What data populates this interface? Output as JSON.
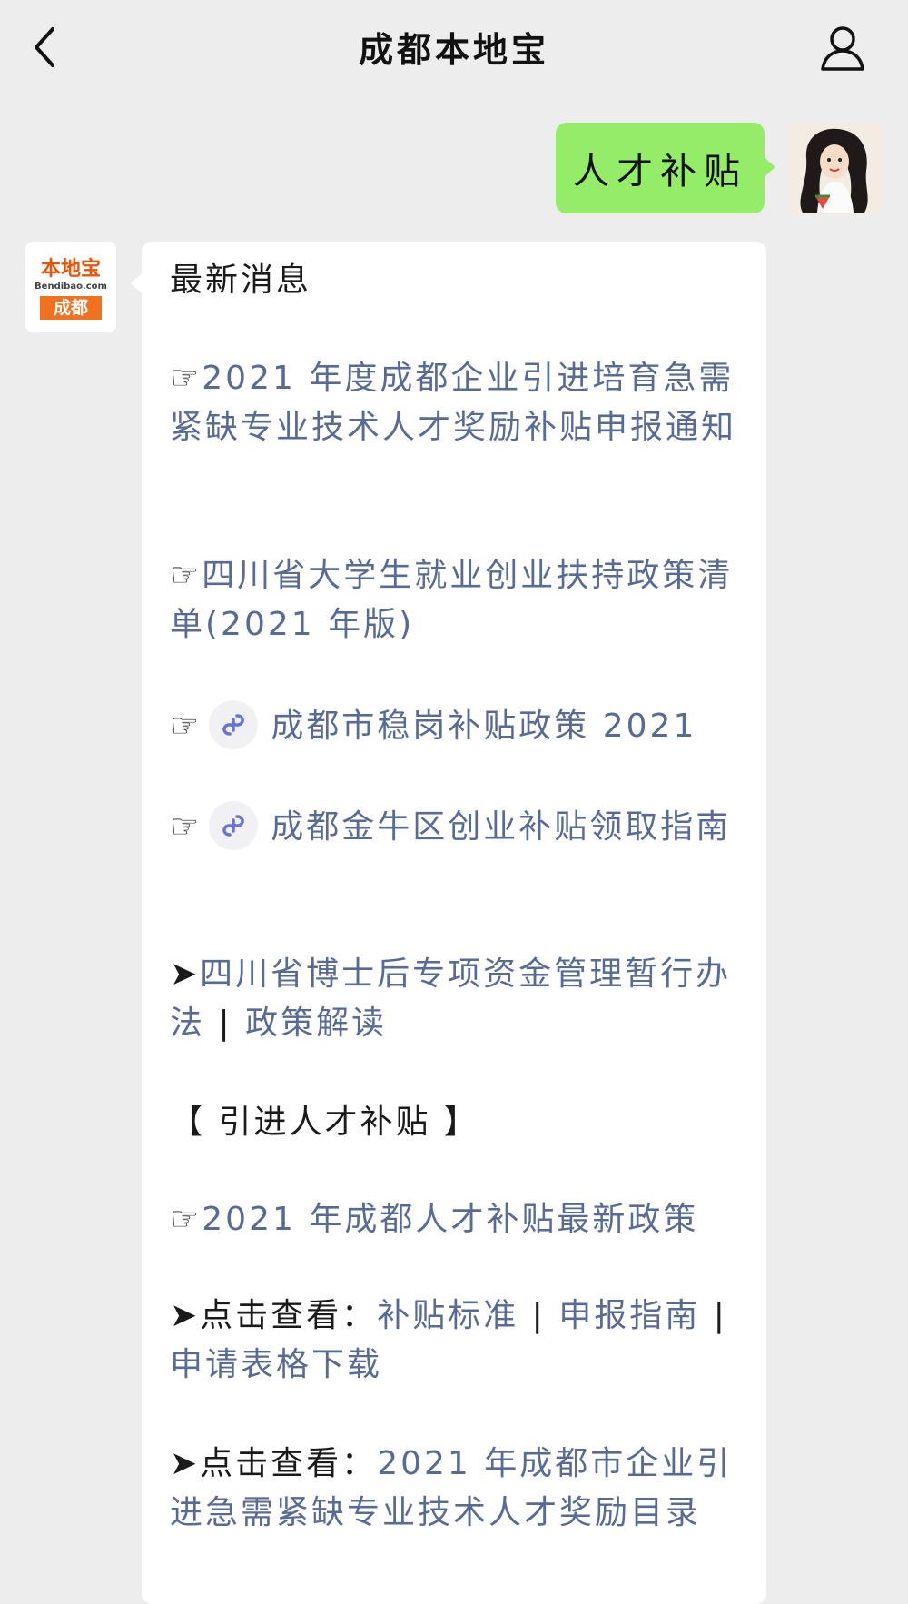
{
  "header": {
    "title": "成都本地宝"
  },
  "outgoing": {
    "text": "人才补贴"
  },
  "bot": {
    "avatar_brand": "本地宝",
    "avatar_domain": "Bendibao.com",
    "avatar_city": "成都"
  },
  "message": {
    "heading": "最新消息",
    "pointer_hand": "☞",
    "arrow": "➤",
    "item1": "2021 年度成都企业引进培育急需紧缺专业技术人才奖励补贴申报通知",
    "item2": "四川省大学生就业创业扶持政策清单(2021 年版)",
    "item3": "成都市稳岗补贴政策 2021",
    "item4": "成都金牛区创业补贴领取指南",
    "item5a": "四川省博士后专项资金管理暂行办法",
    "item5_sep": "|",
    "item5b": "政策解读",
    "section": "【 引进人才补贴 】",
    "item6": "2021 年成都人才补贴最新政策",
    "click_label": "点击查看：",
    "item7a": "补贴标准",
    "item7_sep1": "|",
    "item7b": "申报指南",
    "item7_sep2": "|",
    "item7c": "申请表格下载",
    "item8": "2021 年成都市企业引进急需紧缺专业技术人才奖励目录"
  },
  "colors": {
    "background": "#ededed",
    "outgoing_bubble": "#95ec69",
    "link": "#576b95",
    "brand_orange": "#e8540c"
  }
}
